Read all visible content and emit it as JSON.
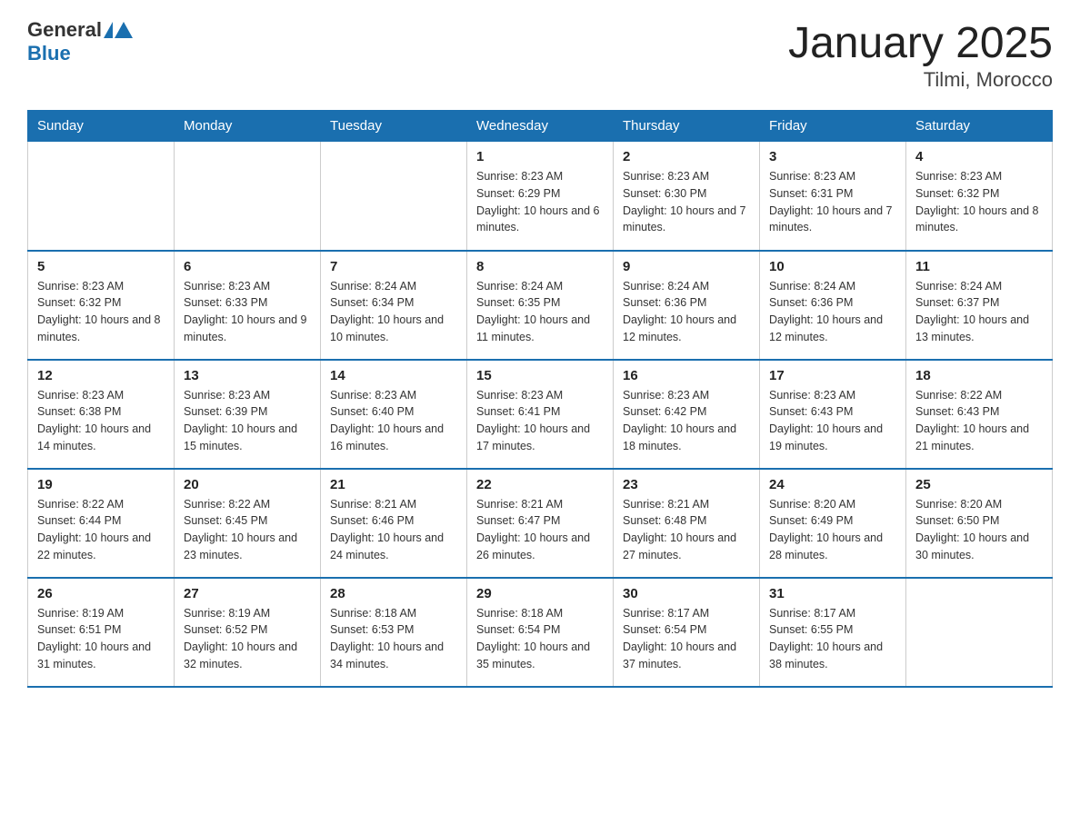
{
  "header": {
    "logo_general": "General",
    "logo_blue": "Blue",
    "title": "January 2025",
    "subtitle": "Tilmi, Morocco"
  },
  "days_of_week": [
    "Sunday",
    "Monday",
    "Tuesday",
    "Wednesday",
    "Thursday",
    "Friday",
    "Saturday"
  ],
  "weeks": [
    [
      {
        "day": "",
        "info": ""
      },
      {
        "day": "",
        "info": ""
      },
      {
        "day": "",
        "info": ""
      },
      {
        "day": "1",
        "info": "Sunrise: 8:23 AM\nSunset: 6:29 PM\nDaylight: 10 hours and 6 minutes."
      },
      {
        "day": "2",
        "info": "Sunrise: 8:23 AM\nSunset: 6:30 PM\nDaylight: 10 hours and 7 minutes."
      },
      {
        "day": "3",
        "info": "Sunrise: 8:23 AM\nSunset: 6:31 PM\nDaylight: 10 hours and 7 minutes."
      },
      {
        "day": "4",
        "info": "Sunrise: 8:23 AM\nSunset: 6:32 PM\nDaylight: 10 hours and 8 minutes."
      }
    ],
    [
      {
        "day": "5",
        "info": "Sunrise: 8:23 AM\nSunset: 6:32 PM\nDaylight: 10 hours and 8 minutes."
      },
      {
        "day": "6",
        "info": "Sunrise: 8:23 AM\nSunset: 6:33 PM\nDaylight: 10 hours and 9 minutes."
      },
      {
        "day": "7",
        "info": "Sunrise: 8:24 AM\nSunset: 6:34 PM\nDaylight: 10 hours and 10 minutes."
      },
      {
        "day": "8",
        "info": "Sunrise: 8:24 AM\nSunset: 6:35 PM\nDaylight: 10 hours and 11 minutes."
      },
      {
        "day": "9",
        "info": "Sunrise: 8:24 AM\nSunset: 6:36 PM\nDaylight: 10 hours and 12 minutes."
      },
      {
        "day": "10",
        "info": "Sunrise: 8:24 AM\nSunset: 6:36 PM\nDaylight: 10 hours and 12 minutes."
      },
      {
        "day": "11",
        "info": "Sunrise: 8:24 AM\nSunset: 6:37 PM\nDaylight: 10 hours and 13 minutes."
      }
    ],
    [
      {
        "day": "12",
        "info": "Sunrise: 8:23 AM\nSunset: 6:38 PM\nDaylight: 10 hours and 14 minutes."
      },
      {
        "day": "13",
        "info": "Sunrise: 8:23 AM\nSunset: 6:39 PM\nDaylight: 10 hours and 15 minutes."
      },
      {
        "day": "14",
        "info": "Sunrise: 8:23 AM\nSunset: 6:40 PM\nDaylight: 10 hours and 16 minutes."
      },
      {
        "day": "15",
        "info": "Sunrise: 8:23 AM\nSunset: 6:41 PM\nDaylight: 10 hours and 17 minutes."
      },
      {
        "day": "16",
        "info": "Sunrise: 8:23 AM\nSunset: 6:42 PM\nDaylight: 10 hours and 18 minutes."
      },
      {
        "day": "17",
        "info": "Sunrise: 8:23 AM\nSunset: 6:43 PM\nDaylight: 10 hours and 19 minutes."
      },
      {
        "day": "18",
        "info": "Sunrise: 8:22 AM\nSunset: 6:43 PM\nDaylight: 10 hours and 21 minutes."
      }
    ],
    [
      {
        "day": "19",
        "info": "Sunrise: 8:22 AM\nSunset: 6:44 PM\nDaylight: 10 hours and 22 minutes."
      },
      {
        "day": "20",
        "info": "Sunrise: 8:22 AM\nSunset: 6:45 PM\nDaylight: 10 hours and 23 minutes."
      },
      {
        "day": "21",
        "info": "Sunrise: 8:21 AM\nSunset: 6:46 PM\nDaylight: 10 hours and 24 minutes."
      },
      {
        "day": "22",
        "info": "Sunrise: 8:21 AM\nSunset: 6:47 PM\nDaylight: 10 hours and 26 minutes."
      },
      {
        "day": "23",
        "info": "Sunrise: 8:21 AM\nSunset: 6:48 PM\nDaylight: 10 hours and 27 minutes."
      },
      {
        "day": "24",
        "info": "Sunrise: 8:20 AM\nSunset: 6:49 PM\nDaylight: 10 hours and 28 minutes."
      },
      {
        "day": "25",
        "info": "Sunrise: 8:20 AM\nSunset: 6:50 PM\nDaylight: 10 hours and 30 minutes."
      }
    ],
    [
      {
        "day": "26",
        "info": "Sunrise: 8:19 AM\nSunset: 6:51 PM\nDaylight: 10 hours and 31 minutes."
      },
      {
        "day": "27",
        "info": "Sunrise: 8:19 AM\nSunset: 6:52 PM\nDaylight: 10 hours and 32 minutes."
      },
      {
        "day": "28",
        "info": "Sunrise: 8:18 AM\nSunset: 6:53 PM\nDaylight: 10 hours and 34 minutes."
      },
      {
        "day": "29",
        "info": "Sunrise: 8:18 AM\nSunset: 6:54 PM\nDaylight: 10 hours and 35 minutes."
      },
      {
        "day": "30",
        "info": "Sunrise: 8:17 AM\nSunset: 6:54 PM\nDaylight: 10 hours and 37 minutes."
      },
      {
        "day": "31",
        "info": "Sunrise: 8:17 AM\nSunset: 6:55 PM\nDaylight: 10 hours and 38 minutes."
      },
      {
        "day": "",
        "info": ""
      }
    ]
  ]
}
